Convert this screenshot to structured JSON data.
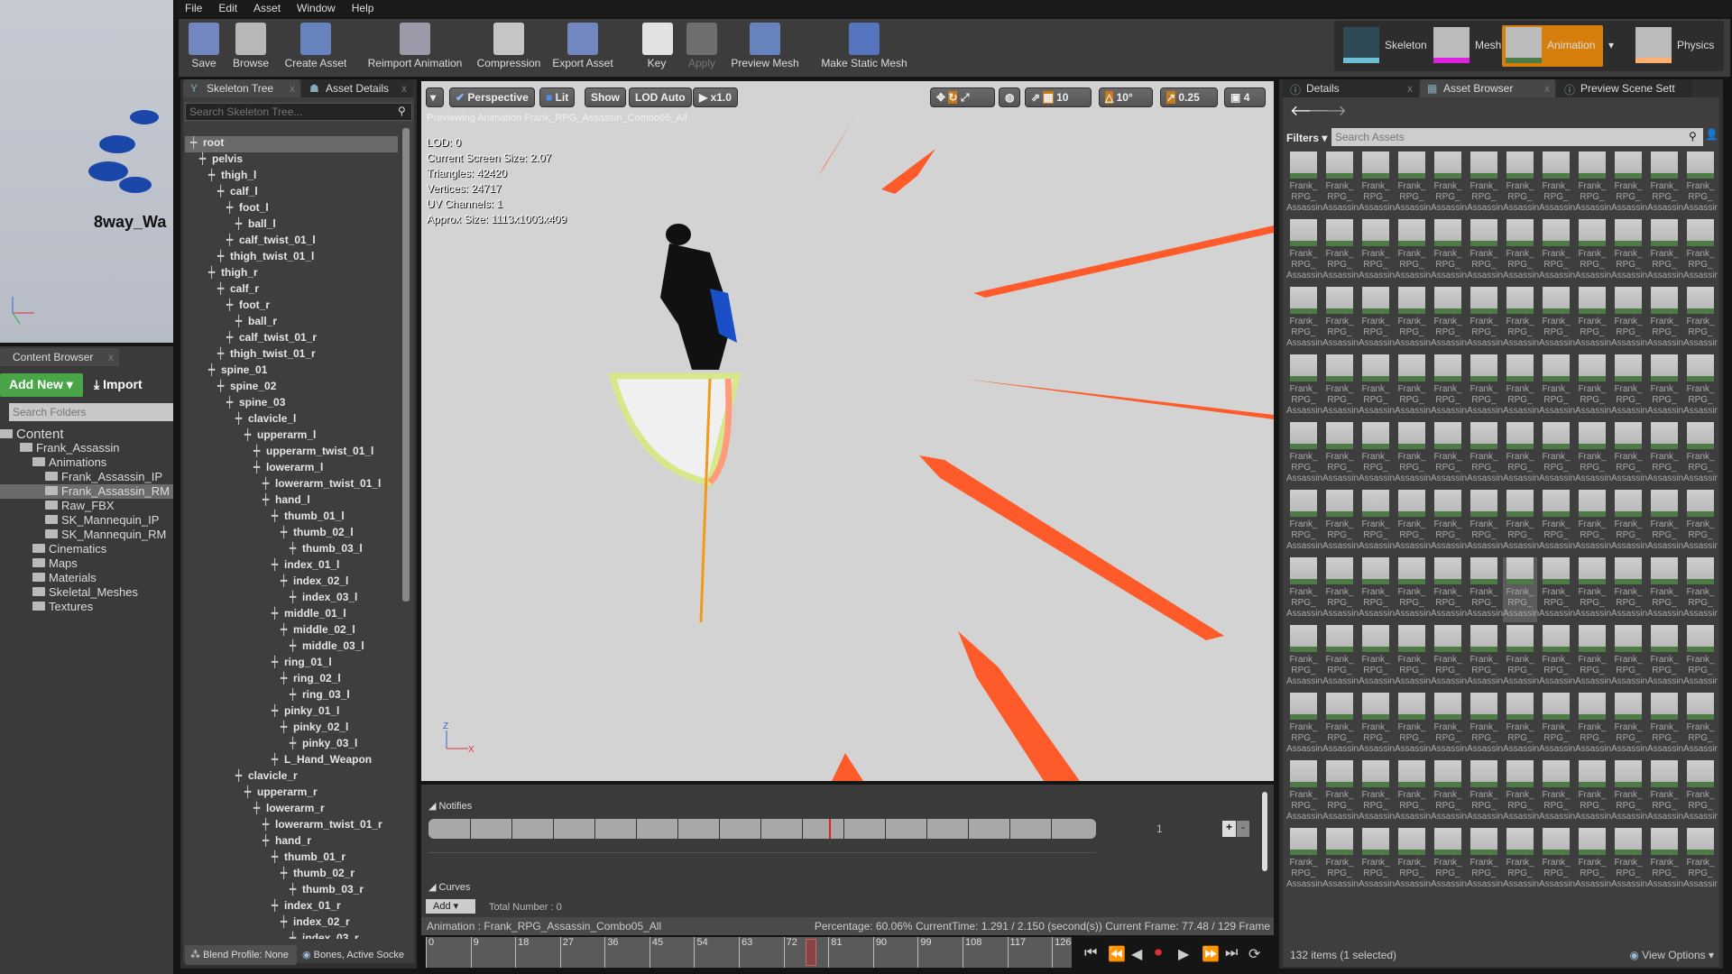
{
  "menu": [
    "File",
    "Edit",
    "Asset",
    "Window",
    "Help"
  ],
  "toolbar": [
    {
      "label": "Save",
      "icon": "save-icon"
    },
    {
      "label": "Browse",
      "icon": "browse-icon"
    },
    {
      "label": "Create Asset",
      "icon": "create-asset-icon"
    },
    {
      "label": "Reimport Animation",
      "icon": "reimport-icon"
    },
    {
      "label": "Compression",
      "icon": "compression-icon"
    },
    {
      "label": "Export Asset",
      "icon": "export-icon"
    },
    {
      "label": "Key",
      "icon": "key-plus-icon"
    },
    {
      "label": "Apply",
      "icon": "apply-check-icon"
    },
    {
      "label": "Preview Mesh",
      "icon": "preview-mesh-icon"
    },
    {
      "label": "Make Static Mesh",
      "icon": "static-mesh-icon"
    }
  ],
  "modes": [
    {
      "label": "Skeleton"
    },
    {
      "label": "Mesh"
    },
    {
      "label": "Animation",
      "active": true
    },
    {
      "label": "Physics"
    }
  ],
  "left_preview": {
    "label": "8way_Wa"
  },
  "content_browser": {
    "tab": "Content Browser",
    "add_new": "Add New",
    "import": "Import",
    "search_placeholder": "Search Folders",
    "folders": [
      {
        "name": "Content",
        "depth": 0
      },
      {
        "name": "Frank_Assassin",
        "depth": 1
      },
      {
        "name": "Animations",
        "depth": 2
      },
      {
        "name": "Frank_Assassin_IP",
        "depth": 3
      },
      {
        "name": "Frank_Assassin_RM",
        "depth": 3,
        "selected": true
      },
      {
        "name": "Raw_FBX",
        "depth": 3
      },
      {
        "name": "SK_Mannequin_IP",
        "depth": 3
      },
      {
        "name": "SK_Mannequin_RM",
        "depth": 3
      },
      {
        "name": "Cinematics",
        "depth": 2
      },
      {
        "name": "Maps",
        "depth": 2
      },
      {
        "name": "Materials",
        "depth": 2
      },
      {
        "name": "Skeletal_Meshes",
        "depth": 2
      },
      {
        "name": "Textures",
        "depth": 2
      }
    ]
  },
  "skeleton": {
    "tabs": [
      "Skeleton Tree",
      "Asset Details"
    ],
    "search_placeholder": "Search Skeleton Tree...",
    "bones": [
      [
        "root",
        0
      ],
      [
        "pelvis",
        1
      ],
      [
        "thigh_l",
        2
      ],
      [
        "calf_l",
        3
      ],
      [
        "foot_l",
        4
      ],
      [
        "ball_l",
        5
      ],
      [
        "calf_twist_01_l",
        4
      ],
      [
        "thigh_twist_01_l",
        3
      ],
      [
        "thigh_r",
        2
      ],
      [
        "calf_r",
        3
      ],
      [
        "foot_r",
        4
      ],
      [
        "ball_r",
        5
      ],
      [
        "calf_twist_01_r",
        4
      ],
      [
        "thigh_twist_01_r",
        3
      ],
      [
        "spine_01",
        2
      ],
      [
        "spine_02",
        3
      ],
      [
        "spine_03",
        4
      ],
      [
        "clavicle_l",
        5
      ],
      [
        "upperarm_l",
        6
      ],
      [
        "upperarm_twist_01_l",
        7
      ],
      [
        "lowerarm_l",
        7
      ],
      [
        "lowerarm_twist_01_l",
        8
      ],
      [
        "hand_l",
        8
      ],
      [
        "thumb_01_l",
        9
      ],
      [
        "thumb_02_l",
        10
      ],
      [
        "thumb_03_l",
        11
      ],
      [
        "index_01_l",
        9
      ],
      [
        "index_02_l",
        10
      ],
      [
        "index_03_l",
        11
      ],
      [
        "middle_01_l",
        9
      ],
      [
        "middle_02_l",
        10
      ],
      [
        "middle_03_l",
        11
      ],
      [
        "ring_01_l",
        9
      ],
      [
        "ring_02_l",
        10
      ],
      [
        "ring_03_l",
        11
      ],
      [
        "pinky_01_l",
        9
      ],
      [
        "pinky_02_l",
        10
      ],
      [
        "pinky_03_l",
        11
      ],
      [
        "L_Hand_Weapon",
        9
      ],
      [
        "clavicle_r",
        5
      ],
      [
        "upperarm_r",
        6
      ],
      [
        "lowerarm_r",
        7
      ],
      [
        "lowerarm_twist_01_r",
        8
      ],
      [
        "hand_r",
        8
      ],
      [
        "thumb_01_r",
        9
      ],
      [
        "thumb_02_r",
        10
      ],
      [
        "thumb_03_r",
        11
      ],
      [
        "index_01_r",
        9
      ],
      [
        "index_02_r",
        10
      ],
      [
        "index_03_r",
        11
      ]
    ],
    "blend_profile": "Blend Profile: None",
    "bones_filter": "Bones, Active Socke"
  },
  "viewport": {
    "perspective": "Perspective",
    "lit": "Lit",
    "show": "Show",
    "lod": "LOD Auto",
    "speed": "x1.0",
    "grid_snap": "10",
    "rot_snap": "10°",
    "scale_snap": "0.25",
    "camera_speed": "4",
    "previewing": "Previewing Animation Frank_RPG_Assassin_Combo05_All",
    "stats": [
      "LOD: 0",
      "Current Screen Size: 2.07",
      "Triangles: 42420",
      "Vertices: 24717",
      "UV Channels: 1",
      "Approx Size: 1113x1003x409"
    ]
  },
  "notifies": {
    "label": "Notifies",
    "track_number": "1",
    "plus": "+",
    "minus": "-",
    "playhead_percent": 60.06
  },
  "curves": {
    "label": "Curves",
    "add": "Add",
    "total": "Total Number : 0"
  },
  "status": {
    "animation": "Animation :  Frank_RPG_Assassin_Combo05_All",
    "details": "Percentage:  60.06% CurrentTime:  1.291 / 2.150 (second(s)) Current Frame:  77.48 / 129 Frame"
  },
  "timeline": {
    "ticks": [
      "0",
      "9",
      "18",
      "27",
      "36",
      "45",
      "54",
      "63",
      "72",
      "81",
      "90",
      "99",
      "108",
      "117",
      "126"
    ],
    "current_frame": 77.48,
    "total_frames": 129
  },
  "right": {
    "tabs": [
      "Details",
      "Asset Browser",
      "Preview Scene Sett"
    ],
    "filters": "Filters",
    "search_placeholder": "Search Assets",
    "asset_label": "Frank_ RPG_ Assassin",
    "asset_count": 132,
    "selected_index": 78,
    "footer": "132 items (1 selected)",
    "view_options": "View Options"
  },
  "colors": {
    "accent": "#d67e0b",
    "add_new": "#4aa548",
    "streak": "#ff5a2a"
  }
}
